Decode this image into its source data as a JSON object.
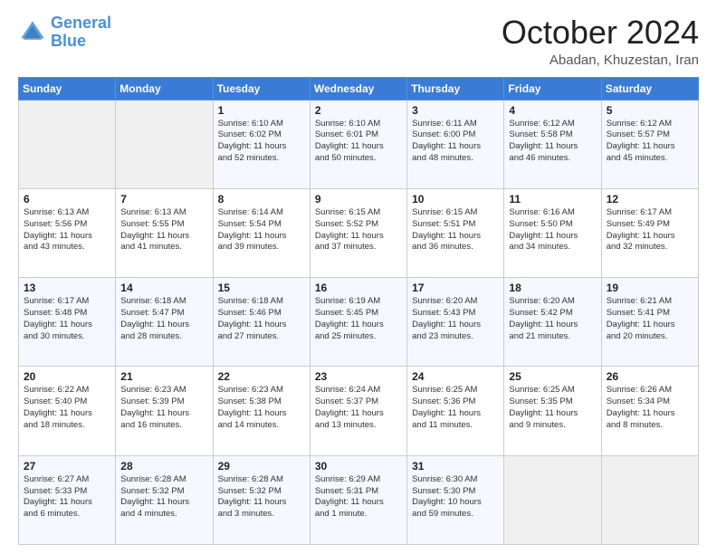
{
  "header": {
    "logo_line1": "General",
    "logo_line2": "Blue",
    "month": "October 2024",
    "location": "Abadan, Khuzestan, Iran"
  },
  "days_of_week": [
    "Sunday",
    "Monday",
    "Tuesday",
    "Wednesday",
    "Thursday",
    "Friday",
    "Saturday"
  ],
  "weeks": [
    [
      {
        "day": "",
        "info": ""
      },
      {
        "day": "",
        "info": ""
      },
      {
        "day": "1",
        "info": "Sunrise: 6:10 AM\nSunset: 6:02 PM\nDaylight: 11 hours\nand 52 minutes."
      },
      {
        "day": "2",
        "info": "Sunrise: 6:10 AM\nSunset: 6:01 PM\nDaylight: 11 hours\nand 50 minutes."
      },
      {
        "day": "3",
        "info": "Sunrise: 6:11 AM\nSunset: 6:00 PM\nDaylight: 11 hours\nand 48 minutes."
      },
      {
        "day": "4",
        "info": "Sunrise: 6:12 AM\nSunset: 5:58 PM\nDaylight: 11 hours\nand 46 minutes."
      },
      {
        "day": "5",
        "info": "Sunrise: 6:12 AM\nSunset: 5:57 PM\nDaylight: 11 hours\nand 45 minutes."
      }
    ],
    [
      {
        "day": "6",
        "info": "Sunrise: 6:13 AM\nSunset: 5:56 PM\nDaylight: 11 hours\nand 43 minutes."
      },
      {
        "day": "7",
        "info": "Sunrise: 6:13 AM\nSunset: 5:55 PM\nDaylight: 11 hours\nand 41 minutes."
      },
      {
        "day": "8",
        "info": "Sunrise: 6:14 AM\nSunset: 5:54 PM\nDaylight: 11 hours\nand 39 minutes."
      },
      {
        "day": "9",
        "info": "Sunrise: 6:15 AM\nSunset: 5:52 PM\nDaylight: 11 hours\nand 37 minutes."
      },
      {
        "day": "10",
        "info": "Sunrise: 6:15 AM\nSunset: 5:51 PM\nDaylight: 11 hours\nand 36 minutes."
      },
      {
        "day": "11",
        "info": "Sunrise: 6:16 AM\nSunset: 5:50 PM\nDaylight: 11 hours\nand 34 minutes."
      },
      {
        "day": "12",
        "info": "Sunrise: 6:17 AM\nSunset: 5:49 PM\nDaylight: 11 hours\nand 32 minutes."
      }
    ],
    [
      {
        "day": "13",
        "info": "Sunrise: 6:17 AM\nSunset: 5:48 PM\nDaylight: 11 hours\nand 30 minutes."
      },
      {
        "day": "14",
        "info": "Sunrise: 6:18 AM\nSunset: 5:47 PM\nDaylight: 11 hours\nand 28 minutes."
      },
      {
        "day": "15",
        "info": "Sunrise: 6:18 AM\nSunset: 5:46 PM\nDaylight: 11 hours\nand 27 minutes."
      },
      {
        "day": "16",
        "info": "Sunrise: 6:19 AM\nSunset: 5:45 PM\nDaylight: 11 hours\nand 25 minutes."
      },
      {
        "day": "17",
        "info": "Sunrise: 6:20 AM\nSunset: 5:43 PM\nDaylight: 11 hours\nand 23 minutes."
      },
      {
        "day": "18",
        "info": "Sunrise: 6:20 AM\nSunset: 5:42 PM\nDaylight: 11 hours\nand 21 minutes."
      },
      {
        "day": "19",
        "info": "Sunrise: 6:21 AM\nSunset: 5:41 PM\nDaylight: 11 hours\nand 20 minutes."
      }
    ],
    [
      {
        "day": "20",
        "info": "Sunrise: 6:22 AM\nSunset: 5:40 PM\nDaylight: 11 hours\nand 18 minutes."
      },
      {
        "day": "21",
        "info": "Sunrise: 6:23 AM\nSunset: 5:39 PM\nDaylight: 11 hours\nand 16 minutes."
      },
      {
        "day": "22",
        "info": "Sunrise: 6:23 AM\nSunset: 5:38 PM\nDaylight: 11 hours\nand 14 minutes."
      },
      {
        "day": "23",
        "info": "Sunrise: 6:24 AM\nSunset: 5:37 PM\nDaylight: 11 hours\nand 13 minutes."
      },
      {
        "day": "24",
        "info": "Sunrise: 6:25 AM\nSunset: 5:36 PM\nDaylight: 11 hours\nand 11 minutes."
      },
      {
        "day": "25",
        "info": "Sunrise: 6:25 AM\nSunset: 5:35 PM\nDaylight: 11 hours\nand 9 minutes."
      },
      {
        "day": "26",
        "info": "Sunrise: 6:26 AM\nSunset: 5:34 PM\nDaylight: 11 hours\nand 8 minutes."
      }
    ],
    [
      {
        "day": "27",
        "info": "Sunrise: 6:27 AM\nSunset: 5:33 PM\nDaylight: 11 hours\nand 6 minutes."
      },
      {
        "day": "28",
        "info": "Sunrise: 6:28 AM\nSunset: 5:32 PM\nDaylight: 11 hours\nand 4 minutes."
      },
      {
        "day": "29",
        "info": "Sunrise: 6:28 AM\nSunset: 5:32 PM\nDaylight: 11 hours\nand 3 minutes."
      },
      {
        "day": "30",
        "info": "Sunrise: 6:29 AM\nSunset: 5:31 PM\nDaylight: 11 hours\nand 1 minute."
      },
      {
        "day": "31",
        "info": "Sunrise: 6:30 AM\nSunset: 5:30 PM\nDaylight: 10 hours\nand 59 minutes."
      },
      {
        "day": "",
        "info": ""
      },
      {
        "day": "",
        "info": ""
      }
    ]
  ]
}
